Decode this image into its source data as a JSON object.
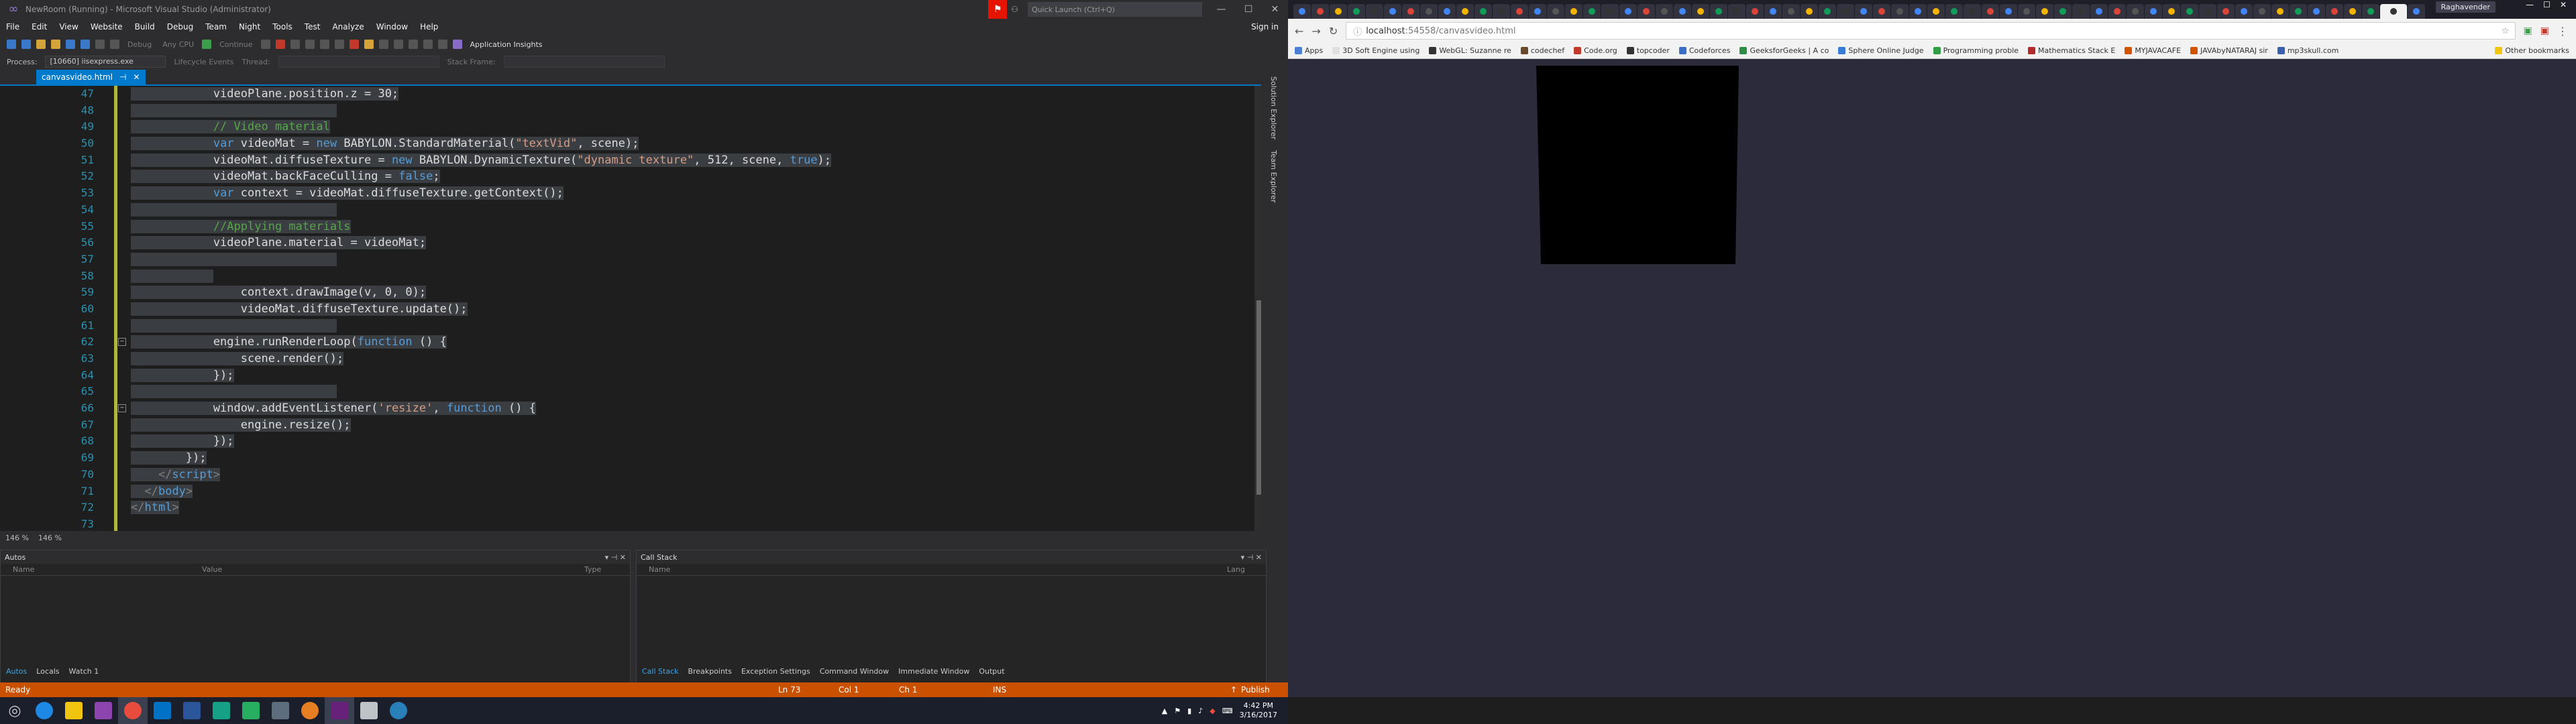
{
  "vs": {
    "title": "NewRoom (Running) - Microsoft Visual Studio (Administrator)",
    "quick_launch": "Quick Launch (Ctrl+Q)",
    "menu": [
      "File",
      "Edit",
      "View",
      "Website",
      "Build",
      "Debug",
      "Team",
      "Night",
      "Tools",
      "Test",
      "Analyze",
      "Window",
      "Help"
    ],
    "sign_in": "Sign in",
    "toolbar": {
      "debug": "Debug",
      "cpu": "Any CPU",
      "continue": "Continue",
      "app_insights": "Application Insights"
    },
    "process_label": "Process:",
    "process_value": "[10660] iisexpress.exe",
    "lifecycle": "Lifecycle Events",
    "thread": "Thread:",
    "stack_frame": "Stack Frame:",
    "tab_name": "canvasvideo.html",
    "zoom": [
      "146 %",
      "146 %"
    ],
    "code_lines": [
      {
        "n": "47",
        "html": "            videoPlane.position.z = 30;"
      },
      {
        "n": "48",
        "html": ""
      },
      {
        "n": "49",
        "html": "            <span class=\"cmt\">// Video material</span>"
      },
      {
        "n": "50",
        "html": "            <span class=\"kw\">var</span> videoMat = <span class=\"kw\">new</span> BABYLON.StandardMaterial(<span class=\"str\">\"textVid\"</span>, scene);"
      },
      {
        "n": "51",
        "html": "            videoMat.diffuseTexture = <span class=\"kw\">new</span> BABYLON.DynamicTexture(<span class=\"str\">\"dynamic texture\"</span>, 512, scene, <span class=\"kw\">true</span>);"
      },
      {
        "n": "52",
        "html": "            videoMat.backFaceCulling = <span class=\"kw\">false</span>;"
      },
      {
        "n": "53",
        "html": "            <span class=\"kw\">var</span> context = videoMat.diffuseTexture.getContext();"
      },
      {
        "n": "54",
        "html": ""
      },
      {
        "n": "55",
        "html": "            <span class=\"cmt\">//Applying materials</span>"
      },
      {
        "n": "56",
        "html": "            videoPlane.material = videoMat;"
      },
      {
        "n": "57",
        "html": ""
      },
      {
        "n": "58",
        "html": "            "
      },
      {
        "n": "59",
        "html": "                context.drawImage(v, 0, 0);"
      },
      {
        "n": "60",
        "html": "                videoMat.diffuseTexture.update();"
      },
      {
        "n": "61",
        "html": ""
      },
      {
        "n": "62",
        "html": "            engine.runRenderLoop(<span class=\"kw\">function</span> () {"
      },
      {
        "n": "63",
        "html": "                scene.render();"
      },
      {
        "n": "64",
        "html": "            });"
      },
      {
        "n": "65",
        "html": ""
      },
      {
        "n": "66",
        "html": "            window.addEventListener(<span class=\"str\">'resize'</span>, <span class=\"kw\">function</span> () {"
      },
      {
        "n": "67",
        "html": "                engine.resize();"
      },
      {
        "n": "68",
        "html": "            });"
      },
      {
        "n": "69",
        "html": "        });"
      },
      {
        "n": "70",
        "html": "    <span class=\"ang\">&lt;/</span><span class=\"tag\">script</span><span class=\"ang\">&gt;</span>"
      },
      {
        "n": "71",
        "html": "  <span class=\"ang\">&lt;/</span><span class=\"tag\">body</span><span class=\"ang\">&gt;</span>"
      },
      {
        "n": "72",
        "html": "<span class=\"ang\">&lt;/</span><span class=\"tag\">html</span><span class=\"ang\">&gt;</span>"
      },
      {
        "n": "73",
        "html": ""
      }
    ],
    "side_tabs": [
      "Solution Explorer",
      "Team Explorer"
    ],
    "autos": {
      "title": "Autos",
      "cols": [
        "Name",
        "Value",
        "Type"
      ],
      "tabs": [
        "Autos",
        "Locals",
        "Watch 1"
      ]
    },
    "callstack": {
      "title": "Call Stack",
      "cols": [
        "Name",
        "Lang"
      ],
      "tabs": [
        "Call Stack",
        "Breakpoints",
        "Exception Settings",
        "Command Window",
        "Immediate Window",
        "Output"
      ]
    },
    "status": {
      "ready": "Ready",
      "ln": "Ln 73",
      "col": "Col 1",
      "ch": "Ch 1",
      "ins": "INS",
      "publish": "Publish"
    }
  },
  "chrome": {
    "user": "Raghavender",
    "url_host": "localhost",
    "url_path": ":54558/canvasvideo.html",
    "bookmarks": [
      {
        "label": "Apps",
        "color": "#4a7fd4"
      },
      {
        "label": "3D Soft Engine using",
        "color": "#e0e0e0"
      },
      {
        "label": "WebGL: Suzanne re",
        "color": "#333333"
      },
      {
        "label": "codechef",
        "color": "#6b4a2a"
      },
      {
        "label": "Code.org",
        "color": "#c0392b"
      },
      {
        "label": "topcoder",
        "color": "#333333"
      },
      {
        "label": "Codeforces",
        "color": "#3b6fc4"
      },
      {
        "label": "GeeksforGeeks | A co",
        "color": "#2f8d46"
      },
      {
        "label": "Sphere Online Judge",
        "color": "#3a7bd5"
      },
      {
        "label": "Programming proble",
        "color": "#2f9e44"
      },
      {
        "label": "Mathematics Stack E",
        "color": "#b52b2b"
      },
      {
        "label": "MYJAVACAFE",
        "color": "#d35400"
      },
      {
        "label": "JAVAbyNATARAJ sir",
        "color": "#d35400"
      },
      {
        "label": "mp3skull.com",
        "color": "#3a5fb0"
      }
    ],
    "other_bookmarks": "Other bookmarks"
  },
  "taskbar": {
    "time": "4:42 PM",
    "date": "3/16/2017"
  }
}
